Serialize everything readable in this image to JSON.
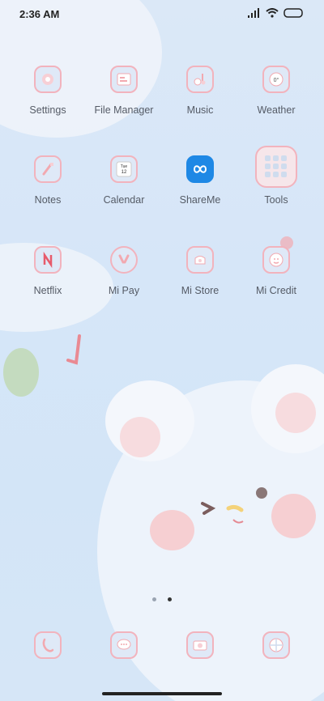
{
  "status": {
    "time": "2:36 AM"
  },
  "apps": [
    {
      "label": "Settings",
      "icon": "settings-icon"
    },
    {
      "label": "File Manager",
      "icon": "file-manager-icon"
    },
    {
      "label": "Music",
      "icon": "music-icon"
    },
    {
      "label": "Weather",
      "icon": "weather-icon"
    },
    {
      "label": "Notes",
      "icon": "notes-icon"
    },
    {
      "label": "Calendar",
      "icon": "calendar-icon"
    },
    {
      "label": "ShareMe",
      "icon": "shareme-icon"
    },
    {
      "label": "Tools",
      "icon": "tools-folder-icon"
    },
    {
      "label": "Netflix",
      "icon": "netflix-icon"
    },
    {
      "label": "Mi Pay",
      "icon": "mi-pay-icon"
    },
    {
      "label": "Mi Store",
      "icon": "mi-store-icon"
    },
    {
      "label": "Mi Credit",
      "icon": "mi-credit-icon"
    }
  ],
  "weather_icon_text": "0°",
  "calendar_icon": {
    "day": "Tue",
    "date": "12"
  },
  "page_indicator": {
    "pages": 2,
    "current": 2
  },
  "dock": [
    {
      "icon": "phone-icon"
    },
    {
      "icon": "messages-icon"
    },
    {
      "icon": "camera-icon"
    },
    {
      "icon": "browser-icon"
    }
  ],
  "colors": {
    "icon_border": "#f2b3bd",
    "icon_bg": "#dfe9f7",
    "shareme_blue": "#1e88e5",
    "label_text": "#555b66"
  }
}
